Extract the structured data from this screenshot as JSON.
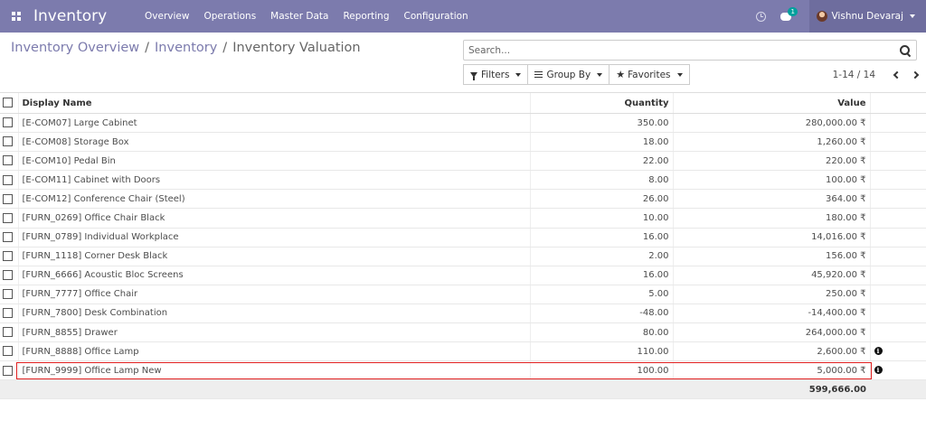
{
  "navbar": {
    "app_title": "Inventory",
    "menu": [
      "Overview",
      "Operations",
      "Master Data",
      "Reporting",
      "Configuration"
    ],
    "chat_badge": "1",
    "user_name": "Vishnu Devaraj",
    "bg_color": "#7c7bad"
  },
  "breadcrumb": {
    "items": [
      "Inventory Overview",
      "Inventory"
    ],
    "current": "Inventory Valuation",
    "separator": "/"
  },
  "search": {
    "placeholder": "Search..."
  },
  "filters": {
    "filters_label": "Filters",
    "group_by_label": "Group By",
    "favorites_label": "Favorites"
  },
  "pager": {
    "value": "1-14 / 14"
  },
  "table": {
    "columns": {
      "name": "Display Name",
      "quantity": "Quantity",
      "value": "Value"
    },
    "rows": [
      {
        "name": "[E-COM07] Large Cabinet",
        "quantity": "350.00",
        "value": "280,000.00 ₹",
        "info": false
      },
      {
        "name": "[E-COM08] Storage Box",
        "quantity": "18.00",
        "value": "1,260.00 ₹",
        "info": false
      },
      {
        "name": "[E-COM10] Pedal Bin",
        "quantity": "22.00",
        "value": "220.00 ₹",
        "info": false
      },
      {
        "name": "[E-COM11] Cabinet with Doors",
        "quantity": "8.00",
        "value": "100.00 ₹",
        "info": false
      },
      {
        "name": "[E-COM12] Conference Chair (Steel)",
        "quantity": "26.00",
        "value": "364.00 ₹",
        "info": false
      },
      {
        "name": "[FURN_0269] Office Chair Black",
        "quantity": "10.00",
        "value": "180.00 ₹",
        "info": false
      },
      {
        "name": "[FURN_0789] Individual Workplace",
        "quantity": "16.00",
        "value": "14,016.00 ₹",
        "info": false
      },
      {
        "name": "[FURN_1118] Corner Desk Black",
        "quantity": "2.00",
        "value": "156.00 ₹",
        "info": false
      },
      {
        "name": "[FURN_6666] Acoustic Bloc Screens",
        "quantity": "16.00",
        "value": "45,920.00 ₹",
        "info": false
      },
      {
        "name": "[FURN_7777] Office Chair",
        "quantity": "5.00",
        "value": "250.00 ₹",
        "info": false
      },
      {
        "name": "[FURN_7800] Desk Combination",
        "quantity": "-48.00",
        "value": "-14,400.00 ₹",
        "info": false
      },
      {
        "name": "[FURN_8855] Drawer",
        "quantity": "80.00",
        "value": "264,000.00 ₹",
        "info": false
      },
      {
        "name": "[FURN_8888] Office Lamp",
        "quantity": "110.00",
        "value": "2,600.00 ₹",
        "info": true
      },
      {
        "name": "[FURN_9999] Office Lamp New",
        "quantity": "100.00",
        "value": "5,000.00 ₹",
        "info": true
      }
    ],
    "total_value": "599,666.00",
    "highlighted_row_index": 13,
    "highlight_color": "#e02020"
  },
  "icons": {
    "apps": "apps-grid-icon",
    "clock": "clock-icon",
    "chat": "chat-icon",
    "search": "search-icon",
    "filter": "filter-icon",
    "group_by": "group-by-icon",
    "favorites": "star-icon",
    "info": "info-icon"
  }
}
